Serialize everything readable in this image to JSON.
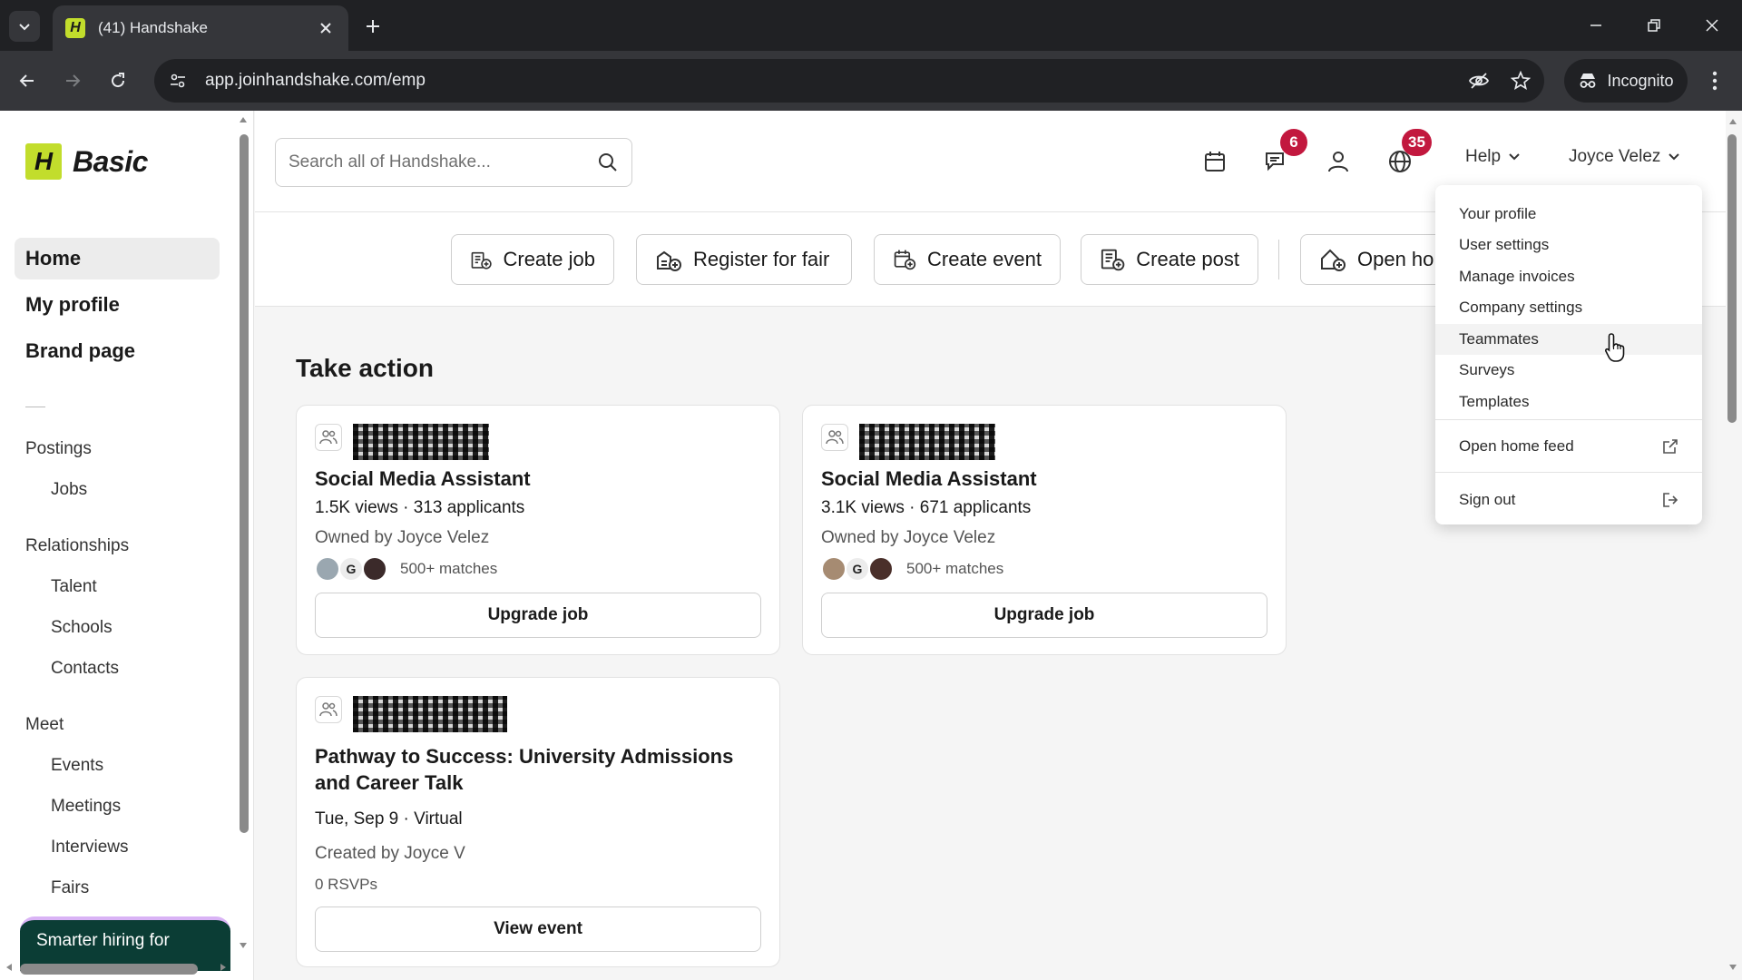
{
  "browser": {
    "tab_title": "(41) Handshake",
    "tab_favicon": "H",
    "url": "app.joinhandshake.com/emp",
    "incognito_label": "Incognito"
  },
  "logo": {
    "mark": "H",
    "text": "Basic"
  },
  "sidebar": {
    "main": [
      "Home",
      "My profile",
      "Brand page"
    ],
    "sections": [
      {
        "label": "Postings",
        "items": [
          "Jobs"
        ]
      },
      {
        "label": "Relationships",
        "items": [
          "Talent",
          "Schools",
          "Contacts"
        ]
      },
      {
        "label": "Meet",
        "items": [
          "Events",
          "Meetings",
          "Interviews",
          "Fairs"
        ]
      }
    ],
    "promo": "Smarter hiring for"
  },
  "header": {
    "search_placeholder": "Search all of Handshake...",
    "messages_badge": "6",
    "globe_badge": "35",
    "help_label": "Help",
    "user_label": "Joyce Velez"
  },
  "quick_actions": [
    "Create job",
    "Register for fair",
    "Create event",
    "Create post",
    "Open ho"
  ],
  "main": {
    "section_title": "Take action",
    "cards": [
      {
        "title": "Social Media Assistant",
        "stats": "1.5K views · 313 applicants",
        "owner": "Owned by Joyce Velez",
        "avatar_letter": "G",
        "matches": "500+ matches",
        "button": "Upgrade job"
      },
      {
        "title": "Social Media Assistant",
        "stats": "3.1K views · 671 applicants",
        "owner": "Owned by Joyce Velez",
        "avatar_letter": "G",
        "matches": "500+ matches",
        "button": "Upgrade job"
      }
    ],
    "event_card": {
      "title_line1": "Pathway to Success: University Admissions",
      "title_line2": "and Career Talk",
      "when": "Tue, Sep 9 · Virtual",
      "creator": "Created by Joyce V",
      "rsvps": "0 RSVPs",
      "button": "View event"
    }
  },
  "dropdown": {
    "items": [
      "Your profile",
      "User settings",
      "Manage invoices",
      "Company settings",
      "Teammates",
      "Surveys",
      "Templates"
    ],
    "open_home_feed": "Open home feed",
    "sign_out": "Sign out",
    "hovered": "Teammates"
  },
  "colors": {
    "brand_lime": "#c2dd2c",
    "badge_red": "#c2183e",
    "promo_green": "#0b3d35"
  }
}
